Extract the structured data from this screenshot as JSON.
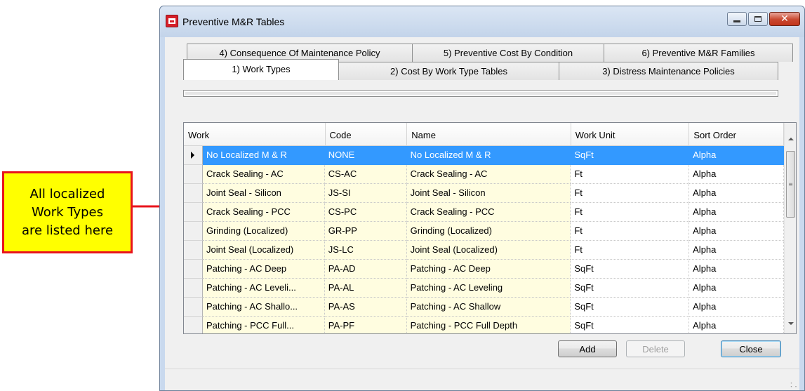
{
  "callout": {
    "text_line1": "All localized",
    "text_line2": "Work Types",
    "text_line3": "are listed here",
    "fill": "#ffff00",
    "border": "#e8141c"
  },
  "window": {
    "title": "Preventive M&R Tables",
    "icon": "app-icon",
    "caption_buttons": [
      "minimize-icon",
      "maximize-icon",
      "close-icon"
    ]
  },
  "tabs": {
    "row_back": [
      {
        "label": "4) Consequence Of Maintenance Policy"
      },
      {
        "label": "5) Preventive Cost By Condition"
      },
      {
        "label": "6) Preventive M&R Families"
      }
    ],
    "row_front": [
      {
        "label": "1) Work Types",
        "selected": true
      },
      {
        "label": "2) Cost By Work Type Tables",
        "selected": false
      },
      {
        "label": "3) Distress Maintenance Policies",
        "selected": false
      }
    ]
  },
  "grid": {
    "columns": [
      "Work",
      "Code",
      "Name",
      "Work Unit",
      "Sort Order"
    ],
    "selected_row": 0,
    "rows": [
      [
        "No Localized M & R",
        "NONE",
        "No Localized M & R",
        "SqFt",
        "Alpha"
      ],
      [
        "Crack Sealing - AC",
        "CS-AC",
        "Crack Sealing - AC",
        "Ft",
        "Alpha"
      ],
      [
        "Joint Seal - Silicon",
        "JS-SI",
        "Joint Seal - Silicon",
        "Ft",
        "Alpha"
      ],
      [
        "Crack Sealing - PCC",
        "CS-PC",
        "Crack Sealing - PCC",
        "Ft",
        "Alpha"
      ],
      [
        "Grinding (Localized)",
        "GR-PP",
        "Grinding (Localized)",
        "Ft",
        "Alpha"
      ],
      [
        "Joint Seal (Localized)",
        "JS-LC",
        "Joint Seal (Localized)",
        "Ft",
        "Alpha"
      ],
      [
        "Patching - AC Deep",
        "PA-AD",
        "Patching - AC Deep",
        "SqFt",
        "Alpha"
      ],
      [
        "Patching - AC Leveli...",
        "PA-AL",
        "Patching - AC Leveling",
        "SqFt",
        "Alpha"
      ],
      [
        "Patching - AC Shallo...",
        "PA-AS",
        "Patching - AC Shallow",
        "SqFt",
        "Alpha"
      ],
      [
        "Patching - PCC Full...",
        "PA-PF",
        "Patching - PCC Full Depth",
        "SqFt",
        "Alpha"
      ]
    ],
    "colors": {
      "row_fill": "#fffde0",
      "selection": "#3399ff"
    }
  },
  "buttons": {
    "add": "Add",
    "delete": "Delete",
    "close": "Close"
  }
}
